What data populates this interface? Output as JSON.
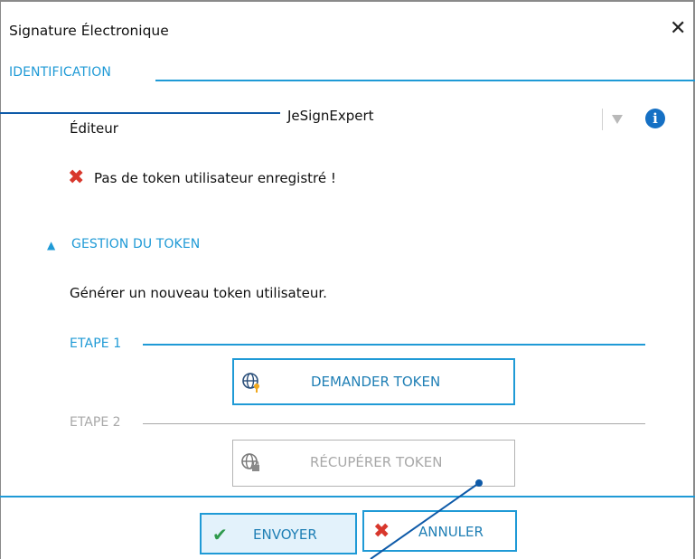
{
  "window": {
    "title": "Signature Électronique",
    "close_glyph": "✕"
  },
  "identification": {
    "section_label": "IDENTIFICATION",
    "editor_label": "Éditeur",
    "editor_value": "JeSignExpert",
    "info_icon": "i",
    "status_icon": "✖",
    "status_text": "Pas de token utilisateur enregistré !"
  },
  "token": {
    "toggle_glyph": "▲",
    "section_label": "GESTION DU TOKEN",
    "instruction": "Générer un nouveau token utilisateur.",
    "step1_label": "ETAPE 1",
    "step1_button": "DEMANDER TOKEN",
    "step2_label": "ETAPE 2",
    "step2_button": "RÉCUPÉRER TOKEN"
  },
  "footer": {
    "send_icon": "✔",
    "send_label": "ENVOYER",
    "cancel_icon": "✖",
    "cancel_label": "ANNULER"
  },
  "colors": {
    "accent": "#1f9ad6",
    "error_red": "#d8372c",
    "success_green": "#2e9a4c",
    "info_blue": "#1570c4",
    "disabled_grey": "#a8a8a8"
  }
}
